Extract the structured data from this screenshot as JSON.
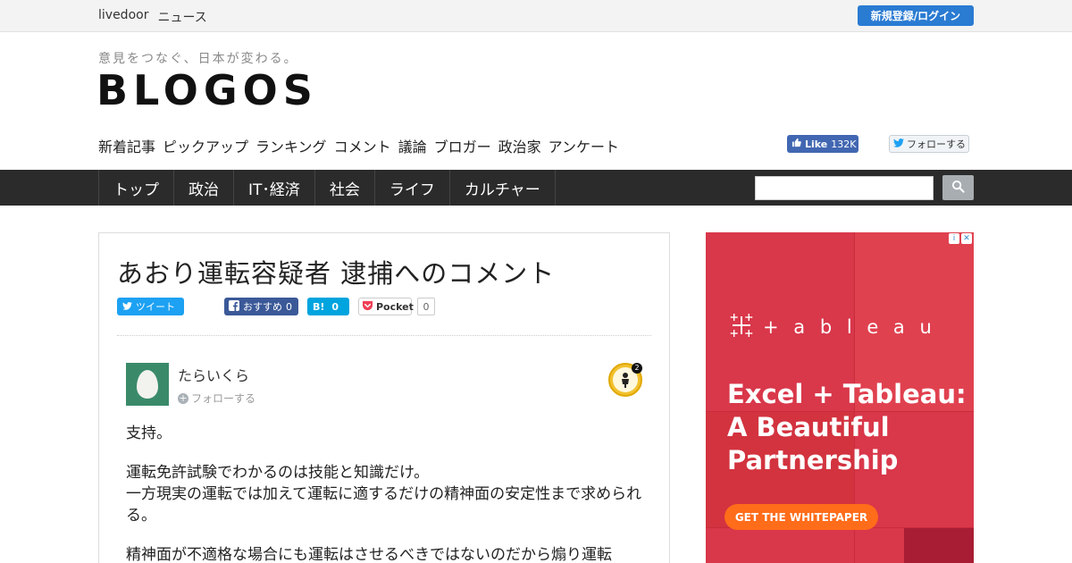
{
  "topbar": {
    "brand_1": "livedoor",
    "brand_2": "ニュース",
    "login_label": "新規登録/ログイン"
  },
  "header": {
    "tagline": "意見をつなぐ、日本が変わる。",
    "logo": "BLOGOS"
  },
  "subnav": [
    "新着記事",
    "ピックアップ",
    "ランキング",
    "コメント",
    "議論",
    "ブロガー",
    "政治家",
    "アンケート"
  ],
  "social": {
    "fb_like_label": "Like",
    "fb_like_count": "132K",
    "tw_follow_label": "フォローする"
  },
  "mainnav": [
    "トップ",
    "政治",
    "IT･経済",
    "社会",
    "ライフ",
    "カルチャー"
  ],
  "search": {
    "placeholder": ""
  },
  "article": {
    "title": "あおり運転容疑者 逮捕へのコメント",
    "share": {
      "tweet_label": "ツイート",
      "fb_label": "おすすめ",
      "fb_count": "0",
      "hatena_label": "B!",
      "hatena_count": "0",
      "pocket_label": "Pocket",
      "pocket_count": "0"
    },
    "comment": {
      "author": "たらいくら",
      "follow_label": "フォローする",
      "badge_count": "2",
      "paragraphs": [
        "支持。",
        "運転免許試験でわかるのは技能と知識だけ。\n一方現実の運転では加えて運転に適するだけの精神面の安定性まで求められる。",
        "精神面が不適格な場合にも運転はさせるべきではないのだから煽り運転"
      ]
    }
  },
  "ad": {
    "brand": "+ a b l e a u",
    "headline_1": "Excel + Tableau:",
    "headline_2": "A Beautiful",
    "headline_3": "Partnership",
    "cta": "GET THE WHITEPAPER",
    "colors": {
      "bg": "#d9374a",
      "cta": "#ff6c1a"
    }
  }
}
